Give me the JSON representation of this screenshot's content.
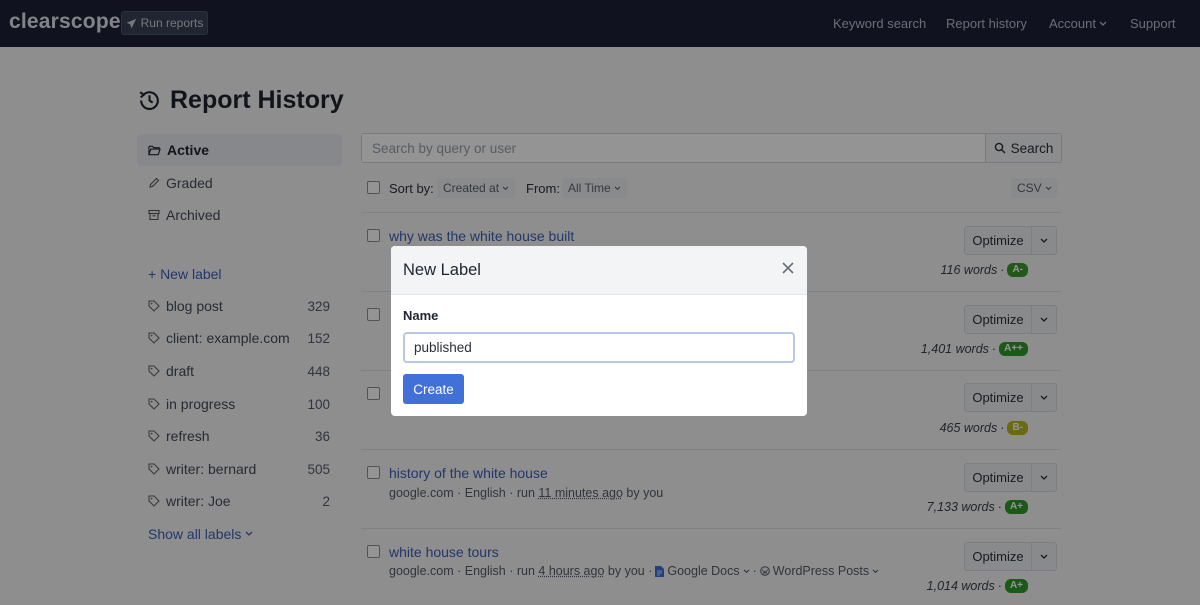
{
  "app": {
    "logo": "clearscope",
    "run_reports": "Run reports",
    "nav": {
      "keyword_search": "Keyword search",
      "report_history": "Report history",
      "account": "Account",
      "support": "Support"
    }
  },
  "page": {
    "title": "Report History"
  },
  "sidebar": {
    "filters": [
      {
        "label": "Active",
        "icon": "folder-open-icon"
      },
      {
        "label": "Graded",
        "icon": "pencil-icon"
      },
      {
        "label": "Archived",
        "icon": "archive-icon"
      }
    ],
    "new_label": "+ New label",
    "labels": [
      {
        "name": "blog post",
        "count": "329"
      },
      {
        "name": "client: example.com",
        "count": "152"
      },
      {
        "name": "draft",
        "count": "448"
      },
      {
        "name": "in progress",
        "count": "100"
      },
      {
        "name": "refresh",
        "count": "36"
      },
      {
        "name": "writer: bernard",
        "count": "505"
      },
      {
        "name": "writer: Joe",
        "count": "2"
      }
    ],
    "show_all": "Show all labels"
  },
  "search": {
    "placeholder": "Search by query or user",
    "button": "Search"
  },
  "filters": {
    "sort_label": "Sort by:",
    "sort_value": "Created at",
    "from_label": "From:",
    "from_value": "All Time",
    "export": "CSV"
  },
  "reports": [
    {
      "title": "why was the white house built",
      "meta_prefix": "",
      "meta_time": "",
      "meta_suffix": "",
      "optimize": "Optimize",
      "words": "116 words",
      "grade": "A-",
      "grade_color": "#3d9a2a"
    },
    {
      "title": "",
      "meta_prefix": "",
      "meta_time": "",
      "meta_suffix": "",
      "optimize": "Optimize",
      "words": "1,401 words",
      "grade": "A++",
      "grade_color": "#2f9a2a"
    },
    {
      "title": "",
      "meta_prefix": "",
      "meta_time": "",
      "meta_suffix": "",
      "optimize": "Optimize",
      "words": "465 words",
      "grade": "B-",
      "grade_color": "#b9b51e"
    },
    {
      "title": "history of the white house",
      "meta_prefix": "google.com · English · run ",
      "meta_time": "11 minutes ago",
      "meta_suffix": " by you",
      "optimize": "Optimize",
      "words": "7,133 words",
      "grade": "A+",
      "grade_color": "#2f9a2a"
    },
    {
      "title": "white house tours",
      "meta_prefix": "google.com · English · run ",
      "meta_time": "4 hours ago",
      "meta_suffix": " by you ·",
      "integration_1": "Google Docs",
      "integration_2": "WordPress Posts",
      "optimize": "Optimize",
      "words": "1,014 words",
      "grade": "A+",
      "grade_color": "#2f9a2a"
    }
  ],
  "modal": {
    "title": "New Label",
    "field_label": "Name",
    "input_value": "published",
    "create": "Create"
  }
}
